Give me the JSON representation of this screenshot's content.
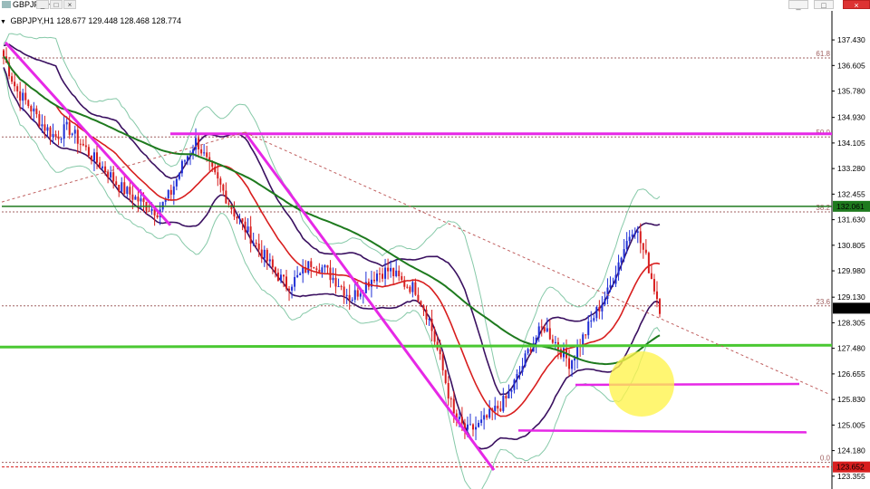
{
  "window": {
    "title": "GBPJPY,H1",
    "minimize": "_",
    "maximize": "□",
    "close": "×"
  },
  "header": {
    "symbol": "GBPJPY,H1",
    "ohlc": "128.677 129.448 128.468 128.774"
  },
  "colors": {
    "background": "#ffffff",
    "bull_candle": "#1f2fd6",
    "bear_candle": "#d81e1e",
    "magenta": "#e628e6",
    "green_line": "#4ac832",
    "ma_slow": "#1e7a1e",
    "ma_fast": "#d81e1e",
    "envelope": "#3a1060",
    "bollinger": "#86c9a8",
    "highlight": "#fff34a"
  },
  "chart_data": {
    "type": "candlestick",
    "symbol": "GBPJPY",
    "timeframe": "H1",
    "ylim": [
      123.35,
      137.9
    ],
    "y_ticks": [
      "137.430",
      "136.605",
      "135.780",
      "134.930",
      "134.105",
      "133.280",
      "132.455",
      "131.630",
      "130.805",
      "129.980",
      "129.130",
      "128.305",
      "127.480",
      "126.655",
      "125.830",
      "125.005",
      "124.180",
      "123.355"
    ],
    "price_labels": [
      {
        "value": 132.061,
        "text": "132.061",
        "color": "#1e7a1e"
      },
      {
        "value": 128.774,
        "text": "128.774",
        "color": "#000000"
      },
      {
        "value": 123.652,
        "text": "123.652",
        "color": "#d81e1e"
      }
    ],
    "fibonacci": [
      {
        "level": "61.8",
        "price": 136.85
      },
      {
        "level": "50.0",
        "price": 134.3
      },
      {
        "level": "38.2",
        "price": 131.88
      },
      {
        "level": "23.6",
        "price": 128.85
      },
      {
        "level": "0.0",
        "price": 123.8
      }
    ],
    "horizontal_lines": [
      {
        "price": 134.4,
        "color": "#e628e6",
        "kind": "resistance"
      },
      {
        "price": 132.061,
        "color": "#1e7a1e",
        "kind": "level"
      },
      {
        "price": 127.58,
        "color": "#4ac832",
        "kind": "support"
      },
      {
        "price": 126.3,
        "color": "#e628e6",
        "kind": "support"
      },
      {
        "price": 124.8,
        "color": "#e628e6",
        "kind": "support"
      },
      {
        "price": 123.652,
        "color": "#d81e1e",
        "kind": "low"
      }
    ],
    "close_path": [
      136.9,
      135.8,
      135.3,
      134.7,
      134.3,
      134.6,
      134.1,
      133.6,
      133.2,
      132.7,
      132.4,
      132.1,
      131.9,
      132.5,
      133.5,
      134.2,
      133.3,
      132.6,
      131.8,
      131.2,
      130.6,
      130.0,
      129.5,
      129.8,
      130.3,
      130.0,
      129.6,
      129.1,
      129.5,
      129.9,
      130.0,
      129.6,
      129.4,
      128.5,
      127.0,
      125.3,
      124.8,
      125.0,
      125.4,
      125.8,
      126.6,
      127.6,
      128.2,
      127.6,
      127.0,
      127.8,
      128.6,
      129.3,
      130.5,
      131.5,
      130.3,
      128.8
    ]
  }
}
